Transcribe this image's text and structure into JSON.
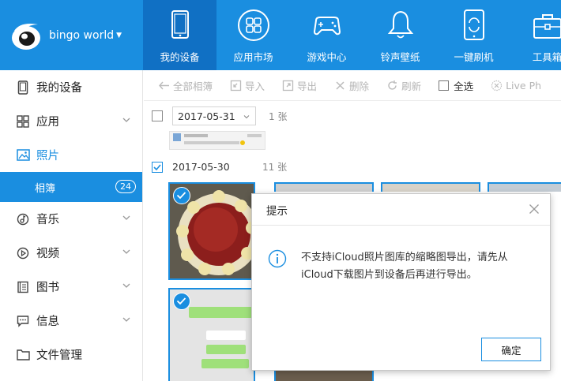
{
  "app": {
    "account_name": "bingo world",
    "accent_color": "#1a8ee0"
  },
  "nav": {
    "items": [
      {
        "label": "我的设备",
        "icon": "tablet-icon",
        "active": true
      },
      {
        "label": "应用市场",
        "icon": "apps-grid-icon"
      },
      {
        "label": "游戏中心",
        "icon": "gamepad-icon"
      },
      {
        "label": "铃声壁纸",
        "icon": "bell-icon"
      },
      {
        "label": "一键刷机",
        "icon": "phone-refresh-icon"
      },
      {
        "label": "工具箱",
        "icon": "toolbox-icon"
      }
    ]
  },
  "sidebar": {
    "items": [
      {
        "label": "我的设备",
        "icon": "device-icon"
      },
      {
        "label": "应用",
        "icon": "apps-icon"
      },
      {
        "label": "照片",
        "icon": "photo-icon",
        "selected": true
      },
      {
        "label": "音乐",
        "icon": "music-icon"
      },
      {
        "label": "视频",
        "icon": "video-icon"
      },
      {
        "label": "图书",
        "icon": "book-icon"
      },
      {
        "label": "信息",
        "icon": "message-icon"
      },
      {
        "label": "文件管理",
        "icon": "folder-icon"
      }
    ],
    "sub_item": {
      "label": "相簿",
      "count": "24"
    }
  },
  "toolbar": {
    "all_albums": "全部相簿",
    "import": "导入",
    "export": "导出",
    "delete": "删除",
    "refresh": "刷新",
    "select_all": "全选",
    "live_photo": "Live Ph"
  },
  "groups": [
    {
      "date": "2017-05-31",
      "count": "1 张",
      "checked": false
    },
    {
      "date": "2017-05-30",
      "count": "11 张",
      "checked": true
    }
  ],
  "dialog": {
    "title": "提示",
    "message": "不支持iCloud照片图库的缩略图导出，请先从iCloud下载图片到设备后再进行导出。",
    "ok_label": "确定"
  }
}
